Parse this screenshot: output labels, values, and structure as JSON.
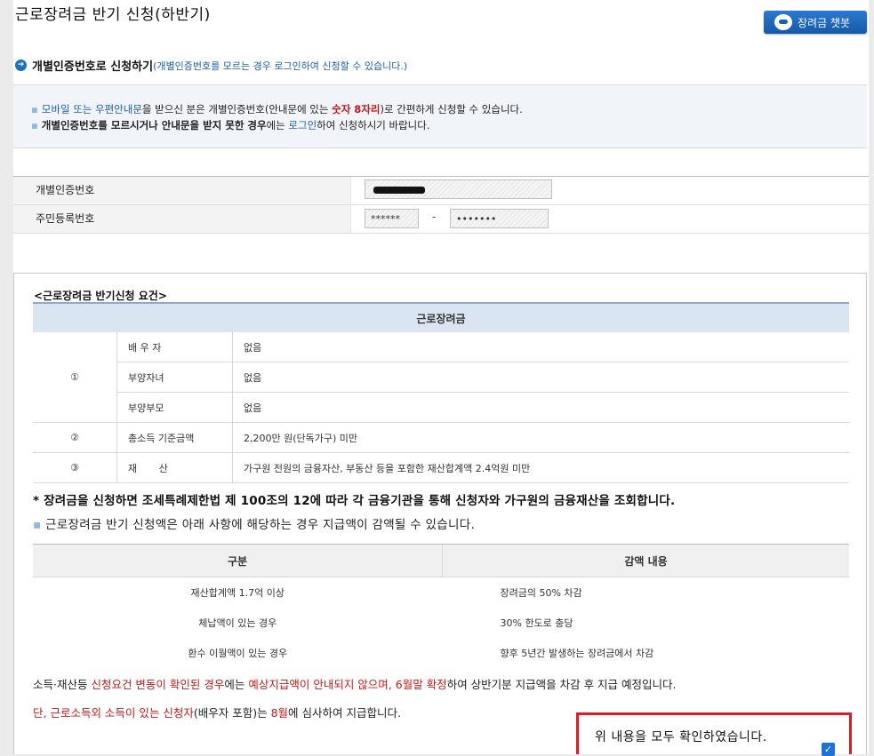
{
  "page": {
    "title": "근로장려금 반기 신청(하반기)",
    "chatbot_label": "장려금 챗봇"
  },
  "section": {
    "heading": "개별인증번호로 신청하기",
    "note": "(개별인증번호를 모르는 경우 로그인하여 신청할 수 있습니다.)"
  },
  "info": {
    "line1_link": "모바일 또는 우편안내문",
    "line1_a": "을 받으신 분은 개별인증번호(안내문에 있는 ",
    "line1_red": "숫자 8자리",
    "line1_b": ")로 간편하게 신청할 수 있습니다.",
    "line2_bold": "개별인증번호를 모르시거나 안내문을 받지 못한 경우",
    "line2_a": "에는 ",
    "line2_link": "로그인",
    "line2_b": "하여 신청하시기 바랍니다."
  },
  "form": {
    "auth_label": "개별인증번호",
    "rrn_label": "주민등록번호",
    "rrn_front": "******",
    "rrn_sep": "-",
    "rrn_back": "•••••••"
  },
  "requirements": {
    "title": "<근로장려금 반기신청 요건>",
    "header": "근로장려금",
    "rows": [
      {
        "num": "①",
        "key": "배 우 자",
        "value": "없음"
      },
      {
        "key": "부양자녀",
        "value": "없음"
      },
      {
        "key": "부양부모",
        "value": "없음"
      },
      {
        "num": "②",
        "key": "총소득 기준금액",
        "value": "2,200만 원(단독가구) 미만"
      },
      {
        "num": "③",
        "key": "재       산",
        "value": "가구원 전원의 금융자산, 부동산 등을 포함한 재산합계액 2.4억원 미만"
      }
    ]
  },
  "warning": {
    "line1": "* 장려금을 신청하면 조세특례제한법 제 100조의 12에 따라 각 금융기관을 통해 신청자와 가구원의 금융재산을 조회합니다.",
    "line2": "근로장려금 반기 신청액은 아래 사항에 해당하는 경우 지급액이 감액될 수 있습니다."
  },
  "reduction": {
    "col1": "구분",
    "col2": "감액 내용",
    "rows": [
      {
        "a": "재산합계액 1.7억 이상",
        "b": "장려금의 50% 차감"
      },
      {
        "a": "체납액이 있는 경우",
        "b": "30% 한도로 충당"
      },
      {
        "a": "환수 이월액이 있는 경우",
        "b": "향후 5년간 발생하는 장려금에서 차감"
      }
    ]
  },
  "footer": {
    "p1_a": "소득·재산등 ",
    "p1_red1": "신청요건 변동이 확인된 경우",
    "p1_b": "에는 ",
    "p1_red2": "예상지급액이 안내되지 않으며, 6월말 확정",
    "p1_c": "하여 상반기분 지급액을 차감 후 지급 예정입니다.",
    "p2_red1": "단, 근로소득외 소득이 있는 신청자",
    "p2_a": "(배우자 포함)는 ",
    "p2_red2": "8월",
    "p2_b": "에 심사하여 지급합니다."
  },
  "confirm": {
    "text": "위 내용을 모두 확인하였습니다.",
    "checked_mark": "✓"
  }
}
